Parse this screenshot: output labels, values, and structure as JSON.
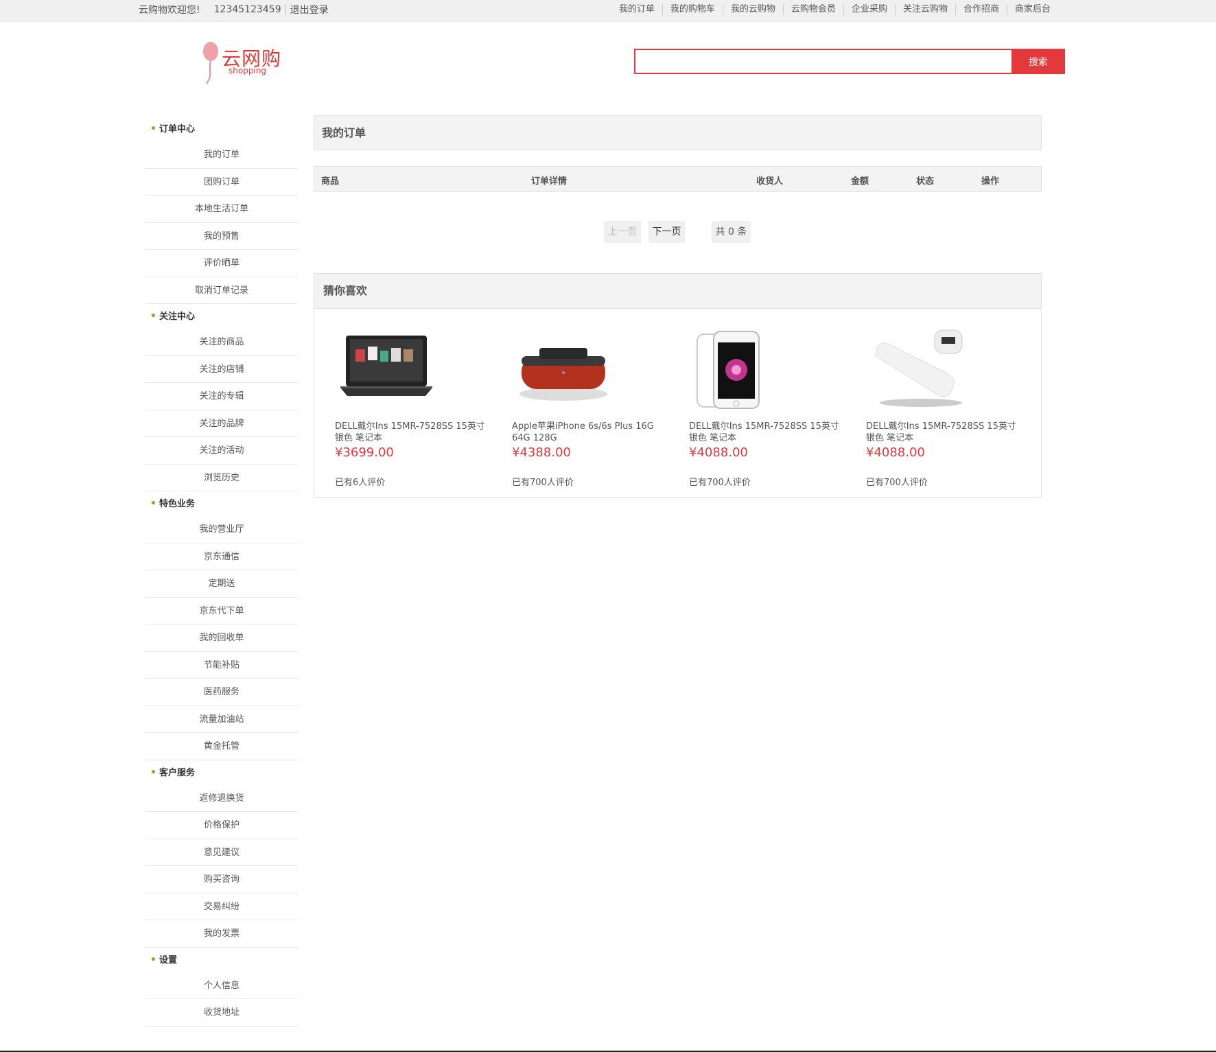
{
  "topbar": {
    "welcome": "云购物欢迎您!",
    "username": "12345123459",
    "logout": "退出登录",
    "links": [
      "我的订单",
      "我的购物车",
      "我的云购物",
      "云购物会员",
      "企业采购",
      "关注云购物",
      "合作招商",
      "商家后台"
    ]
  },
  "logo": {
    "text": "云网购",
    "sub": "shopping"
  },
  "search": {
    "placeholder": "",
    "button": "搜索"
  },
  "sidebar": [
    {
      "title": "订单中心",
      "items": [
        "我的订单",
        "团购订单",
        "本地生活订单",
        "我的预售",
        "评价晒单",
        "取消订单记录"
      ]
    },
    {
      "title": "关注中心",
      "items": [
        "关注的商品",
        "关注的店铺",
        "关注的专辑",
        "关注的品牌",
        "关注的活动",
        "浏览历史"
      ]
    },
    {
      "title": "特色业务",
      "items": [
        "我的营业厅",
        "京东通信",
        "定期送",
        "京东代下单",
        "我的回收单",
        "节能补贴",
        "医药服务",
        "流量加油站",
        "黄金托管"
      ]
    },
    {
      "title": "客户服务",
      "items": [
        "返修退换货",
        "价格保护",
        "意见建议",
        "购买咨询",
        "交易纠纷",
        "我的发票"
      ]
    },
    {
      "title": "设置",
      "items": [
        "个人信息",
        "收货地址"
      ]
    }
  ],
  "orders": {
    "title": "我的订单",
    "columns": [
      "商品",
      "订单详情",
      "收货人",
      "金额",
      "状态",
      "操作"
    ],
    "pager": {
      "prev": "上一页",
      "next": "下一页",
      "total": "共 0 条"
    }
  },
  "recommend": {
    "title": "猜你喜欢",
    "products": [
      {
        "title": "DELL戴尔Ins 15MR-7528SS 15英寸 银色 笔记本",
        "price": "¥3699.00",
        "reviews": "已有6人评价",
        "icon": "laptop-image"
      },
      {
        "title": "Apple苹果iPhone 6s/6s Plus 16G 64G 128G",
        "price": "¥4388.00",
        "reviews": "已有700人评价",
        "icon": "speaker-image"
      },
      {
        "title": "DELL戴尔Ins 15MR-7528SS 15英寸 银色 笔记本",
        "price": "¥4088.00",
        "reviews": "已有700人评价",
        "icon": "phone-image"
      },
      {
        "title": "DELL戴尔Ins 15MR-7528SS 15英寸 银色 笔记本",
        "price": "¥4088.00",
        "reviews": "已有700人评价",
        "icon": "powerbank-image"
      }
    ]
  },
  "colors": {
    "accent": "#e4393c",
    "bullet": "#7ab317",
    "panel": "#f3f3f3"
  }
}
